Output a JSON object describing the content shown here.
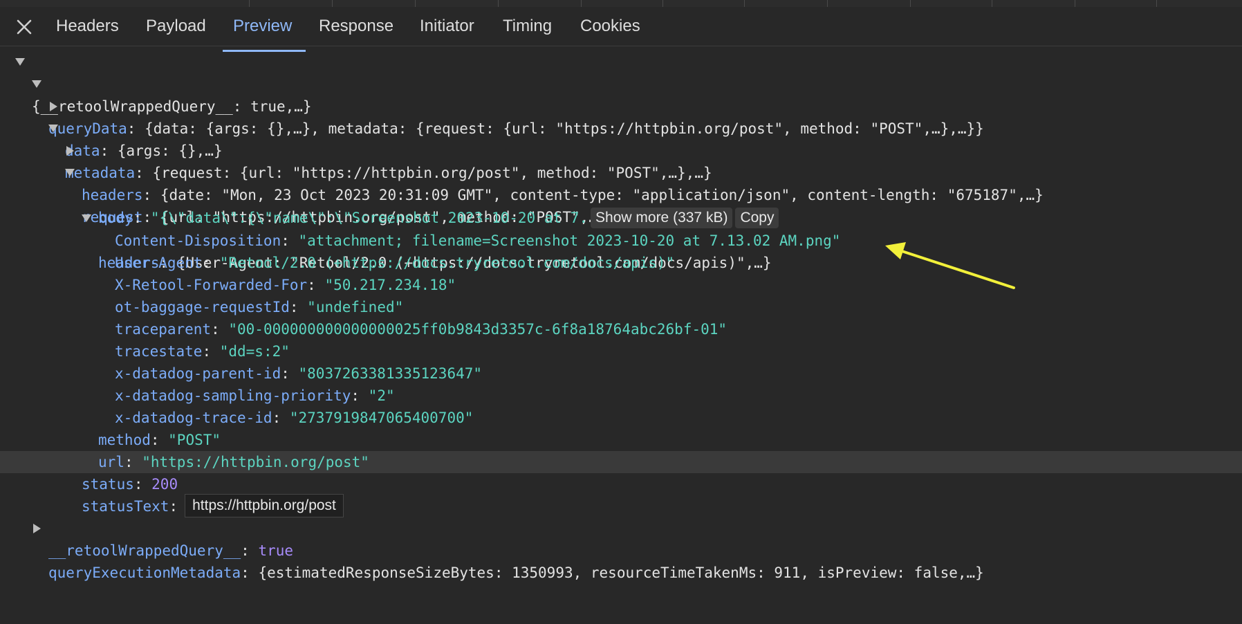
{
  "tabs": [
    "Headers",
    "Payload",
    "Preview",
    "Response",
    "Initiator",
    "Timing",
    "Cookies"
  ],
  "active_tab": "Preview",
  "colors": {
    "accent": "#8fb8f7",
    "key": "#7cacf8",
    "string": "#5cd5c1",
    "number": "#a78bfa",
    "annotation_arrow": "#f2f03a"
  },
  "tree": {
    "root": "{__retoolWrappedQuery__: true,…}",
    "queryData": {
      "key": "queryData",
      "summary": "{data: {args: {},…}, metadata: {request: {url: \"https://httpbin.org/post\", method: \"POST\",…},…}}"
    },
    "data": {
      "key": "data",
      "summary": "{args: {},…}"
    },
    "metadata": {
      "key": "metadata",
      "summary": "{request: {url: \"https://httpbin.org/post\", method: \"POST\",…},…}"
    },
    "meta_headers": {
      "key": "headers",
      "summary": "{date: \"Mon, 23 Oct 2023 20:31:09 GMT\", content-type: \"application/json\", content-length: \"675187\",…}"
    },
    "request": {
      "key": "request",
      "summary": "{url: \"https://httpbin.org/post\", method: \"POST\",…}"
    },
    "body": {
      "key": "body",
      "value": "\"{\\\"data\\\":{\\\"name\\\":\\\"Screenshot 2023-10-20 at 7.",
      "show_more": "Show more (337 kB)",
      "copy": "Copy"
    },
    "req_headers": {
      "key": "headers",
      "summary": "{User-Agent: \"Retool/2.0 (+https://docs.tryretool.com/docs/apis)\",…}"
    },
    "header_entries": [
      {
        "key": "Content-Disposition",
        "value": "\"attachment; filename=Screenshot 2023-10-20 at 7.13.02 AM.png\""
      },
      {
        "key": "User-Agent",
        "value": "\"Retool/2.0 (+https://docs.tryretool.com/docs/apis)\""
      },
      {
        "key": "X-Retool-Forwarded-For",
        "value": "\"50.217.234.18\""
      },
      {
        "key": "ot-baggage-requestId",
        "value": "\"undefined\""
      },
      {
        "key": "traceparent",
        "value": "\"00-000000000000000025ff0b9843d3357c-6f8a18764abc26bf-01\""
      },
      {
        "key": "tracestate",
        "value": "\"dd=s:2\""
      },
      {
        "key": "x-datadog-parent-id",
        "value": "\"8037263381335123647\""
      },
      {
        "key": "x-datadog-sampling-priority",
        "value": "\"2\""
      },
      {
        "key": "x-datadog-trace-id",
        "value": "\"2737919847065400700\""
      }
    ],
    "method": {
      "key": "method",
      "value": "\"POST\""
    },
    "url": {
      "key": "url",
      "value": "\"https://httpbin.org/post\""
    },
    "status": {
      "key": "status",
      "value": "200"
    },
    "statusText": {
      "key": "statusText",
      "tooltip": "https://httpbin.org/post"
    },
    "queryExecutionMetadata": {
      "key": "queryExecutionMetadata",
      "summary": "{estimatedResponseSizeBytes: 1350993, resourceTimeTakenMs: 911, isPreview: false,…}"
    },
    "wrapped": {
      "key": "__retoolWrappedQuery__",
      "value": "true"
    }
  }
}
